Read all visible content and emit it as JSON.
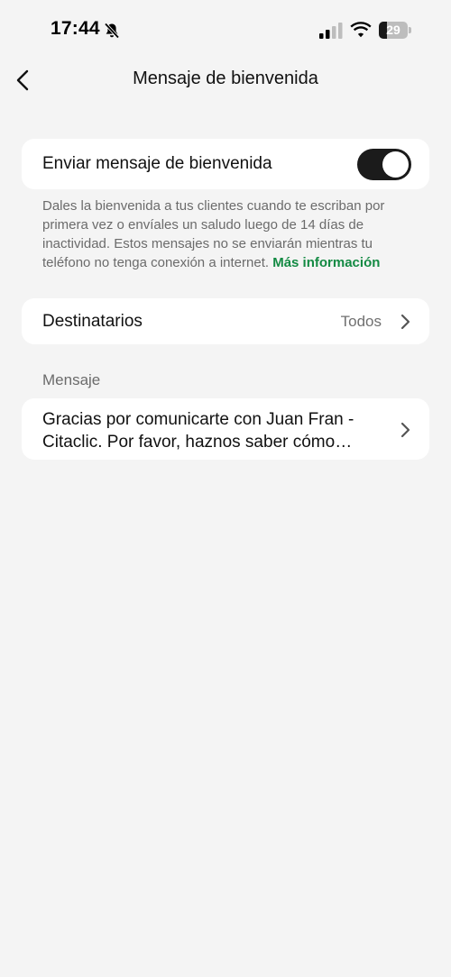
{
  "status_bar": {
    "time": "17:44",
    "battery_percent": 29,
    "battery_label": "29",
    "icons": [
      "bell-slash-icon",
      "cellular-signal-icon",
      "wifi-icon",
      "battery-icon"
    ]
  },
  "header": {
    "title": "Mensaje de bienvenida",
    "back_icon": "chevron-left-icon"
  },
  "welcome": {
    "label": "Enviar mensaje de bienvenida",
    "enabled": true,
    "description": "Dales la bienvenida a tus clientes cuando te escriban por primera vez o envíales un saludo luego de 14 días de inactividad. Estos mensajes no se enviarán mientras tu teléfono no tenga conexión a internet.",
    "more_info_link": "Más información"
  },
  "recipients": {
    "label": "Destinatarios",
    "value": "Todos"
  },
  "message": {
    "section_label": "Mensaje",
    "text": "Gracias por comunicarte con Juan Fran - Citaclic. Por favor, haznos saber cómo podemos ayudarte."
  },
  "colors": {
    "background": "#f4f4f4",
    "card": "#ffffff",
    "toggle_on": "#1b1b1b",
    "link": "#138a43",
    "secondary_text": "#6b6b6b"
  }
}
